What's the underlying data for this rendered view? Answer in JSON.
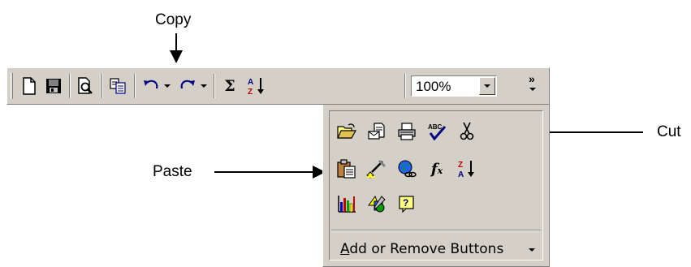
{
  "callouts": {
    "copy": "Copy",
    "paste": "Paste",
    "cut": "Cut"
  },
  "toolbar": {
    "buttons": [
      {
        "name": "new-icon"
      },
      {
        "name": "save-icon"
      },
      {
        "name": "print-preview-icon"
      },
      {
        "name": "copy-icon"
      },
      {
        "name": "undo-icon"
      },
      {
        "name": "redo-icon"
      },
      {
        "name": "autosum-icon"
      },
      {
        "name": "sort-ascending-icon"
      }
    ],
    "sum_glyph": "Σ",
    "zoom_value": "100%",
    "more_glyph": "»"
  },
  "dropdown_panel": {
    "buttons": [
      "open-icon",
      "mail-recipient-icon",
      "print-icon",
      "spelling-icon",
      "cut-icon",
      "paste-icon",
      "format-painter-icon",
      "insert-hyperlink-icon",
      "insert-function-icon",
      "sort-descending-icon",
      "chart-wizard-icon",
      "drawing-icon",
      "help-icon"
    ],
    "fx_glyph": "f",
    "fx_sub": "x",
    "add_remove_label_first": "A",
    "add_remove_label_rest": "dd or Remove Buttons"
  },
  "colors": {
    "face": "#d4d0c8",
    "highlight": "#ffffff",
    "shadow": "#808080"
  }
}
